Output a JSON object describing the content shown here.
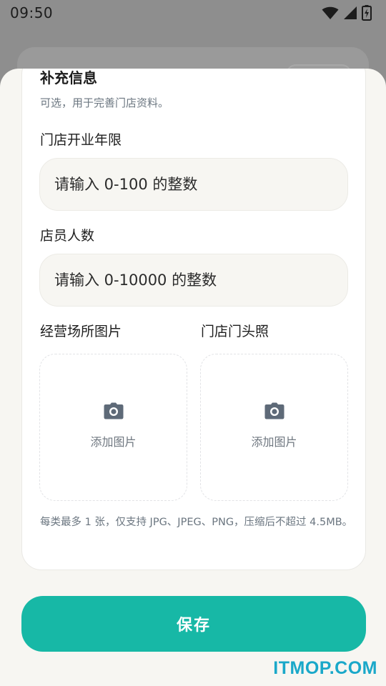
{
  "status_bar": {
    "time": "09:50",
    "icons": [
      "wifi-icon",
      "cellular-signal-icon",
      "battery-charging-icon"
    ]
  },
  "sheet": {
    "section_title": "补充信息",
    "section_subtitle": "可选，用于完善门店资料。",
    "fields": {
      "years": {
        "label": "门店开业年限",
        "placeholder": "请输入 0-100 的整数",
        "value": ""
      },
      "staff": {
        "label": "店员人数",
        "placeholder": "请输入 0-10000 的整数",
        "value": ""
      }
    },
    "uploads": [
      {
        "label": "经营场所图片",
        "action": "添加图片",
        "icon": "camera-icon"
      },
      {
        "label": "门店门头照",
        "action": "添加图片",
        "icon": "camera-icon"
      }
    ],
    "hint": "每类最多 1 张，仅支持 JPG、JPEG、PNG，压缩后不超过 4.5MB。",
    "save_label": "保存"
  },
  "watermark": "ITMOP.COM",
  "colors": {
    "accent": "#17b8a6",
    "sheet_bg": "#f7f6f2",
    "input_bg": "#f7f6f2",
    "muted_text": "#6b7680",
    "watermark": "#1aa8c9"
  }
}
